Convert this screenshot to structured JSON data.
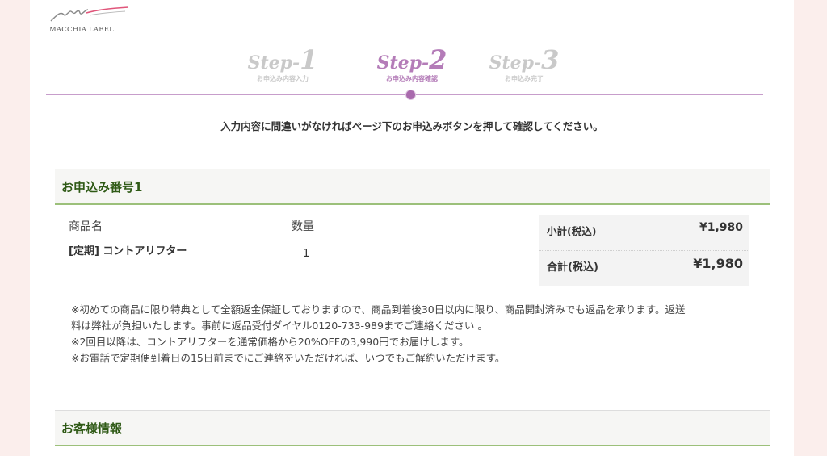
{
  "brand": {
    "logo_text": "MACCHIA LABEL"
  },
  "steps": [
    {
      "prefix": "Step-",
      "number": "1",
      "sub": "お申込み内容入力"
    },
    {
      "prefix": "Step-",
      "number": "2",
      "sub": "お申込み内容確認"
    },
    {
      "prefix": "Step-",
      "number": "3",
      "sub": "お申込み完了"
    }
  ],
  "instruction": "入力内容に間違いがなければページ下のお申込みボタンを押して確認してください。",
  "order": {
    "header": "お申込み番号1",
    "col_product": "商品名",
    "col_quantity": "数量",
    "product_name": "[定期] コントアリフター",
    "quantity": "1",
    "subtotal_label": "小計(税込)",
    "subtotal_value": "¥1,980",
    "total_label": "合計(税込)",
    "total_value": "¥1,980",
    "notes": [
      "※初めての商品に限り特典として全額返金保証しておりますので、商品到着後30日以内に限り、商品開封済みでも返品を承ります。返送",
      "料は弊社が負担いたします。事前に返品受付ダイヤル0120-733-989までご連絡ください 。",
      "※2回目以降は、コントアリフターを通常価格から20%OFFの3,990円でお届けします。",
      "※お電話で定期便到着日の15日前までにご連絡をいただければ、いつでもご解約いただけます。"
    ]
  },
  "customer": {
    "header": "お客様情報"
  }
}
